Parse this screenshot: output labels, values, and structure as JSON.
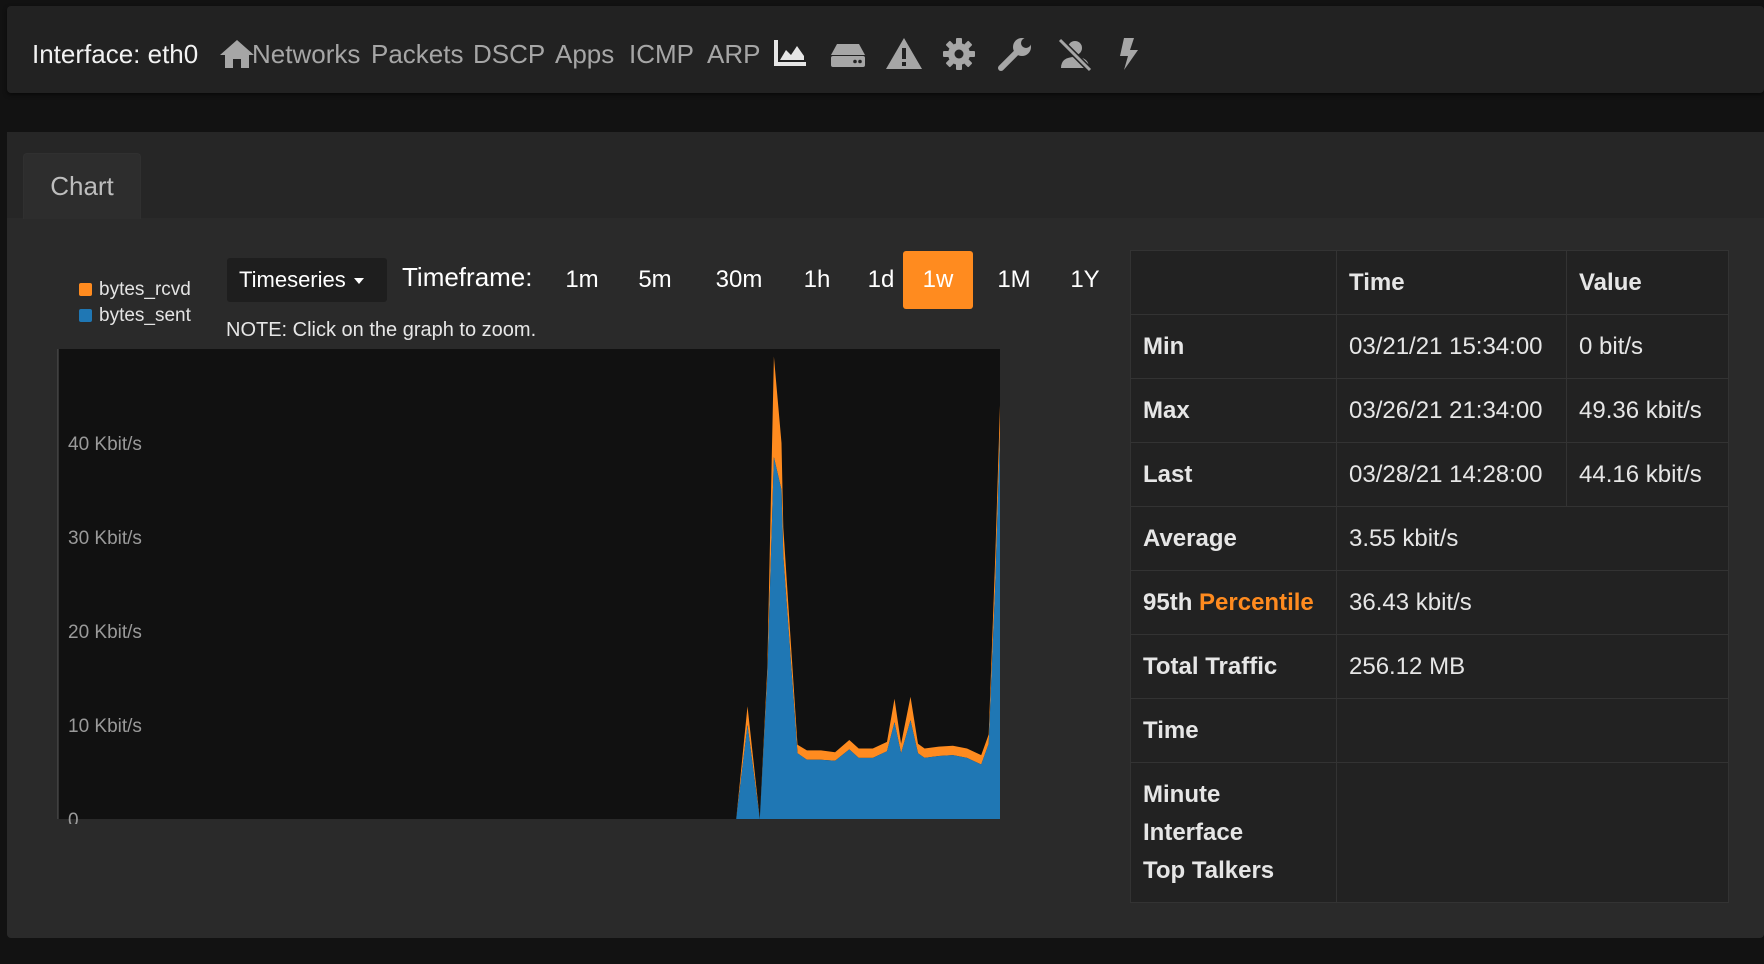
{
  "navbar": {
    "title": "Interface: eth0",
    "links": [
      "Networks",
      "Packets",
      "DSCP",
      "Apps",
      "ICMP",
      "ARP"
    ],
    "icons": [
      "home-icon",
      "area-chart-icon",
      "hdd-icon",
      "warning-icon",
      "gear-icon",
      "wrench-icon",
      "user-slash-icon",
      "bolt-icon"
    ]
  },
  "tabs": [
    "Chart"
  ],
  "controls": {
    "view_select": "Timeseries",
    "timeframe_label": "Timeframe:",
    "timeframes": [
      "1m",
      "5m",
      "30m",
      "1h",
      "1d",
      "1w",
      "1M",
      "1Y"
    ],
    "active_timeframe": "1w",
    "note": "NOTE: Click on the graph to zoom."
  },
  "colors": {
    "accent": "#ff8b1f",
    "bytes_rcvd": "#ff8b1f",
    "bytes_sent": "#1f77b4"
  },
  "chart_data": {
    "type": "area",
    "stacked": true,
    "legend_position": "top-left",
    "grid": false,
    "y_tick_labels": [
      "0",
      "10 Kbit/s",
      "20 Kbit/s",
      "30 Kbit/s",
      "40 Kbit/s"
    ],
    "y_ticks": [
      0,
      10,
      20,
      30,
      40
    ],
    "ylim": [
      0,
      50
    ],
    "xlim": [
      0,
      100
    ],
    "x": [
      0,
      71,
      72,
      73.2,
      74.5,
      75.3,
      76,
      76.8,
      77,
      78.5,
      79.5,
      81,
      82.5,
      84,
      85,
      86.5,
      88,
      88.8,
      89.5,
      90.5,
      91.3,
      92,
      93.5,
      95,
      96.5,
      98,
      98.8,
      99.5,
      100
    ],
    "series": [
      {
        "name": "bytes_sent",
        "values": [
          0,
          0,
          0,
          10,
          0,
          15,
          38.5,
          35,
          28,
          7,
          6.3,
          6.3,
          6.2,
          7.4,
          6.5,
          6.5,
          7.2,
          10.3,
          7,
          10.5,
          7,
          6.5,
          6.7,
          6.8,
          6.5,
          5.8,
          8,
          25,
          41
        ]
      },
      {
        "name": "bytes_rcvd",
        "values": [
          0,
          0,
          0,
          2,
          0,
          1,
          10.7,
          5,
          3,
          0.9,
          1,
          1,
          0.9,
          1,
          1,
          1,
          1,
          2.5,
          1,
          2.5,
          1,
          1,
          1,
          1,
          1,
          1,
          1,
          3,
          3
        ]
      }
    ]
  },
  "stats": {
    "headers": [
      "",
      "Time",
      "Value"
    ],
    "min": {
      "label": "Min",
      "time": "03/21/21 15:34:00",
      "value": "0 bit/s"
    },
    "max": {
      "label": "Max",
      "time": "03/26/21 21:34:00",
      "value": "49.36 kbit/s"
    },
    "last": {
      "label": "Last",
      "time": "03/28/21 14:28:00",
      "value": "44.16 kbit/s"
    },
    "average": {
      "label": "Average",
      "value": "3.55 kbit/s"
    },
    "percentile": {
      "label_prefix": "95th",
      "label_highlight": "Percentile",
      "value": "36.43 kbit/s"
    },
    "total_traffic": {
      "label": "Total Traffic",
      "value": "256.12 MB"
    },
    "time": {
      "label": "Time",
      "value": ""
    },
    "links": [
      "Minute",
      "Interface",
      "Top Talkers"
    ]
  }
}
